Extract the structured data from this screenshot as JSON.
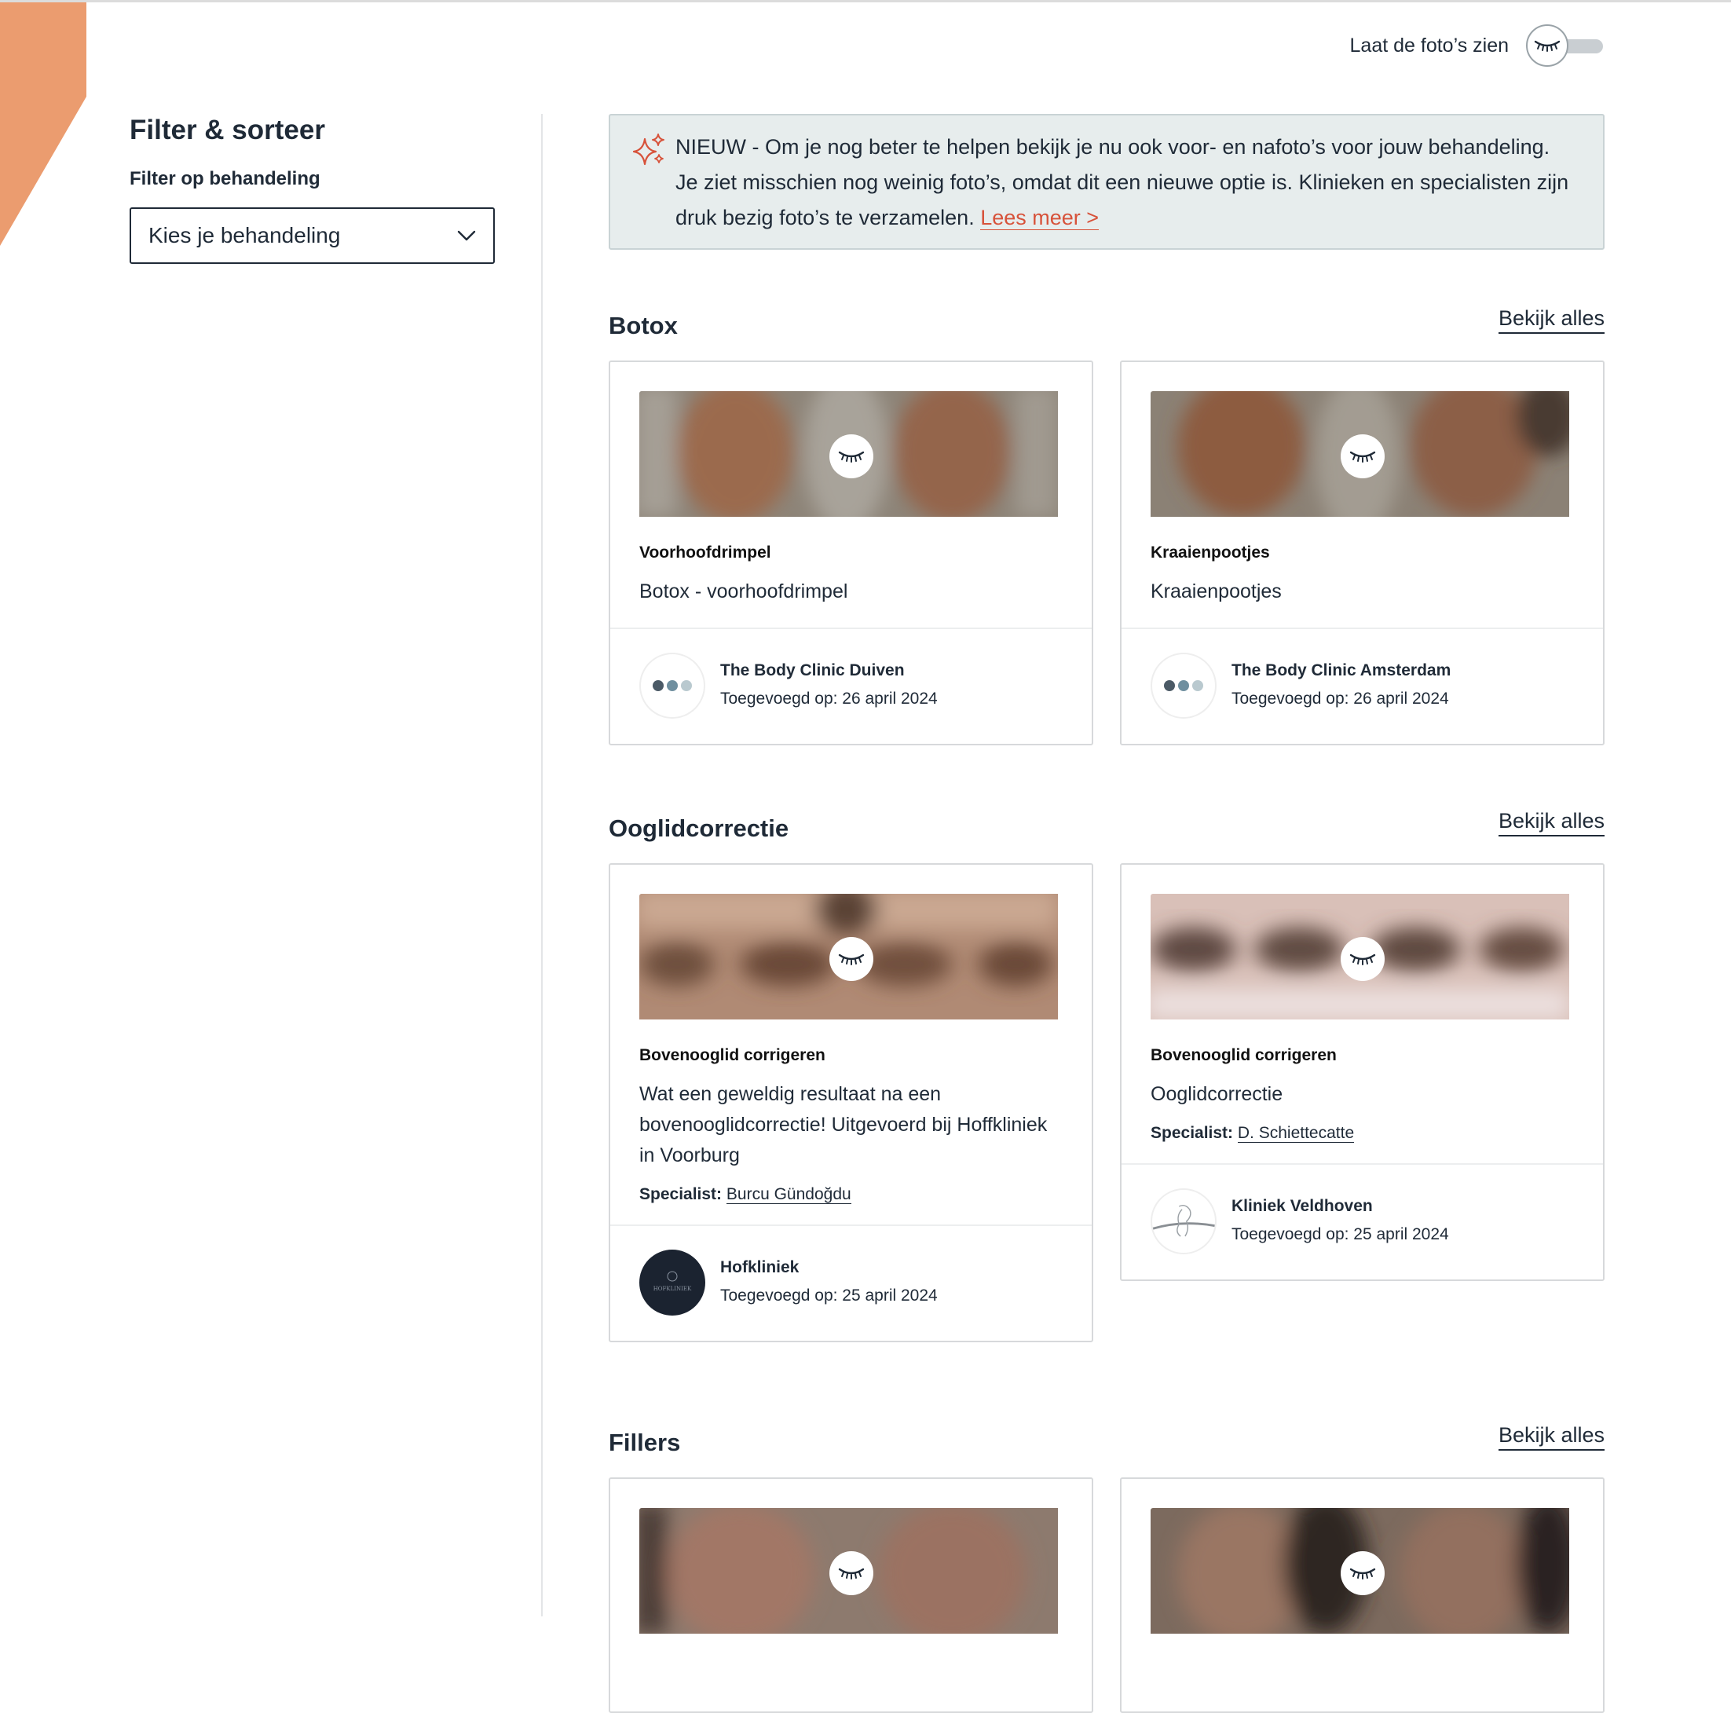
{
  "toggle": {
    "label": "Laat de foto’s zien",
    "on": false
  },
  "sidebar": {
    "title": "Filter & sorteer",
    "filter_label": "Filter op behandeling",
    "select_value": "Kies je behandeling"
  },
  "banner": {
    "text": "NIEUW - Om je nog beter te helpen bekijk je nu ook voor- en nafoto’s voor jouw behandeling. Je ziet misschien nog weinig foto’s, omdat dit een nieuwe optie is. Klinieken en specialisten zijn druk bezig foto’s te verzamelen.",
    "link": "Lees meer >"
  },
  "colors": {
    "accent": "#d7523a",
    "brand_orange": "#eb9c6f",
    "banner_bg": "#e7eded",
    "text": "#1f2a37"
  },
  "sections": [
    {
      "title": "Botox",
      "view_all": "Bekijk alles",
      "cards": [
        {
          "type": "Voorhoofdrimpel",
          "description": "Botox - voorhoofdrimpel",
          "clinic": "The Body Clinic Duiven",
          "added": "Toegevoegd op: 26 april 2024"
        },
        {
          "type": "Kraaienpootjes",
          "description": "Kraaienpootjes",
          "clinic": "The Body Clinic Amsterdam",
          "added": "Toegevoegd op: 26 april 2024"
        }
      ]
    },
    {
      "title": "Ooglidcorrectie",
      "view_all": "Bekijk alles",
      "cards": [
        {
          "type": "Bovenooglid corrigeren",
          "description": "Wat een geweldig resultaat na een bovenooglidcorrectie! Uitgevoerd bij Hoffkliniek in Voorburg",
          "specialist_label": "Specialist:",
          "specialist": "Burcu Gündoğdu",
          "clinic": "Hofkliniek",
          "logo_text": "HOFKLINIEK",
          "added": "Toegevoegd op: 25 april 2024"
        },
        {
          "type": "Bovenooglid corrigeren",
          "description": "Ooglidcorrectie",
          "specialist_label": "Specialist:",
          "specialist": "D. Schiettecatte",
          "clinic": "Kliniek Veldhoven",
          "added": "Toegevoegd op: 25 april 2024"
        }
      ]
    },
    {
      "title": "Fillers",
      "view_all": "Bekijk alles"
    }
  ]
}
